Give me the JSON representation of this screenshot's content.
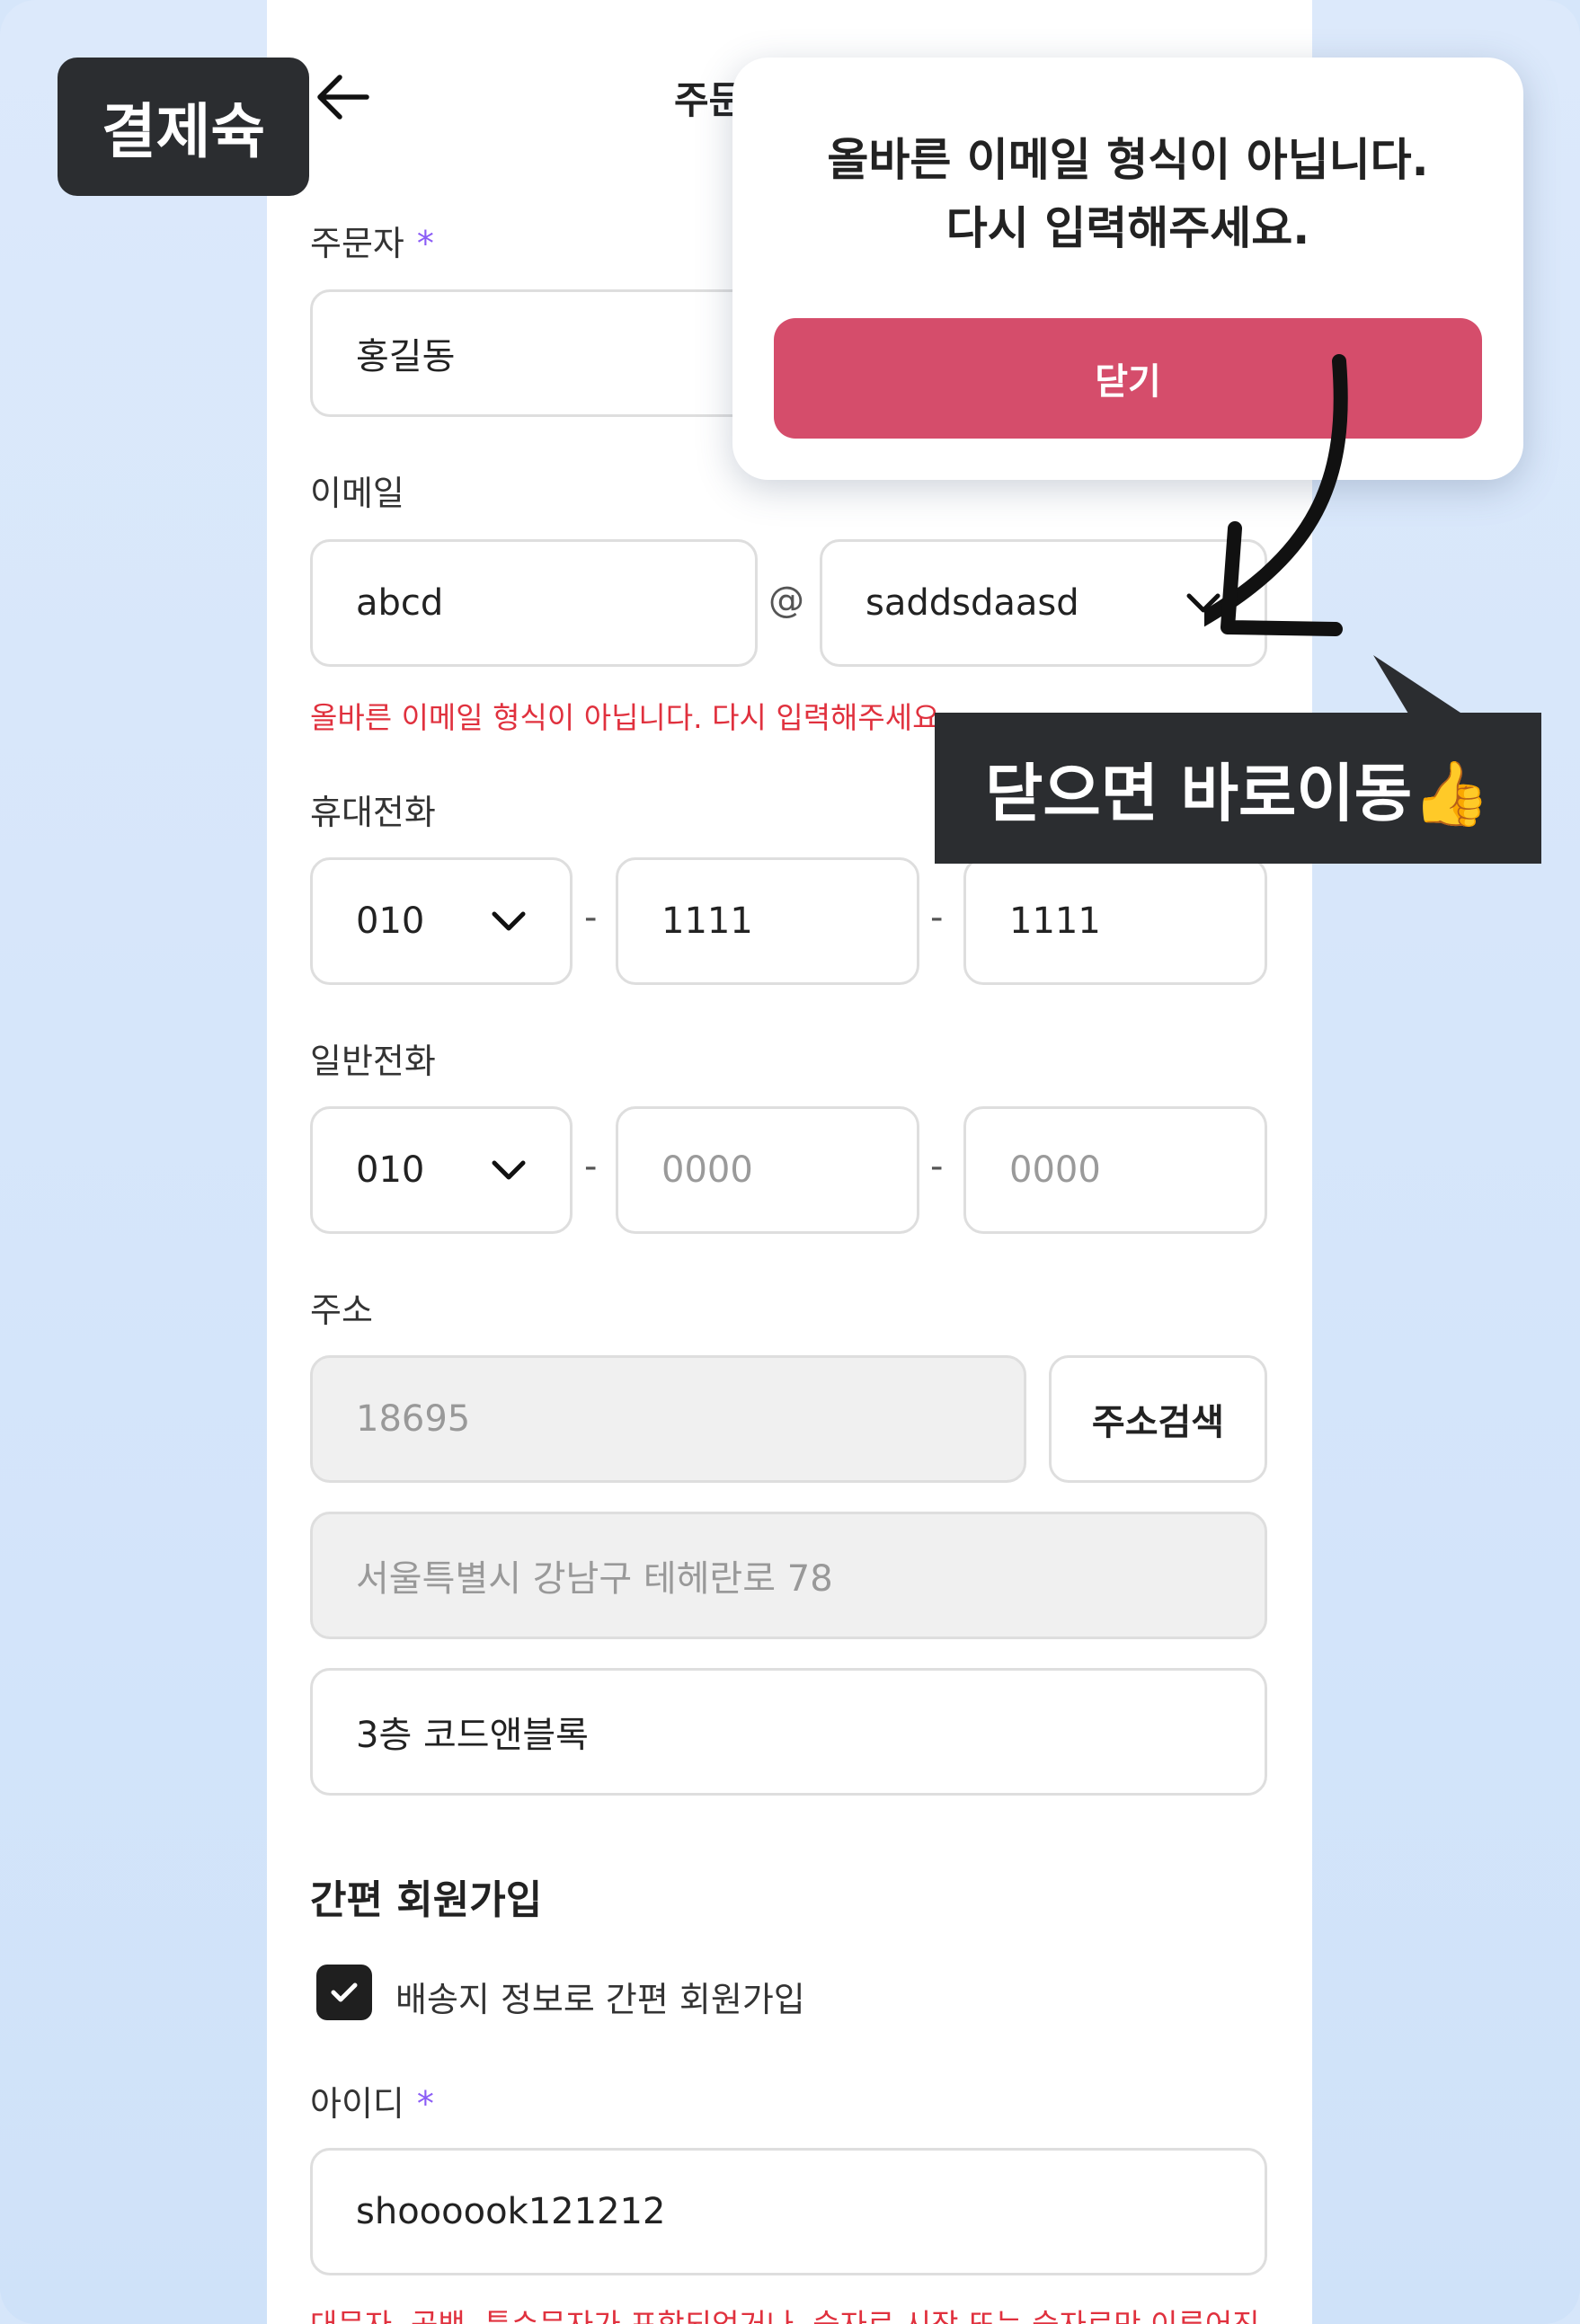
{
  "header": {
    "title": "주문"
  },
  "corner_tag": "결제슉",
  "modal": {
    "line1": "올바른 이메일 형식이 아닙니다.",
    "line2": "다시 입력해주세요.",
    "close_label": "닫기"
  },
  "callout": {
    "text": "닫으면 바로이동👍"
  },
  "orderer": {
    "label": "주문자",
    "required_mark": "*",
    "value": "홍길동"
  },
  "email": {
    "label": "이메일",
    "local": "abcd",
    "at": "@",
    "domain": "saddsdaasd",
    "error": "올바른 이메일 형식이 아닙니다. 다시 입력해주세요."
  },
  "mobile": {
    "label": "휴대전화",
    "prefix": "010",
    "mid": "1111",
    "last": "1111",
    "dash": "-"
  },
  "phone": {
    "label": "일반전화",
    "prefix": "010",
    "mid_placeholder": "0000",
    "last_placeholder": "0000",
    "dash": "-"
  },
  "address": {
    "label": "주소",
    "zip": "18695",
    "search_label": "주소검색",
    "line1": "서울특별시 강남구 테헤란로 78",
    "line2": "3층 코드앤블록"
  },
  "signup": {
    "title": "간편 회원가입",
    "checkbox_label": "배송지 정보로 간편 회원가입",
    "checked": true
  },
  "userid": {
    "label": "아이디",
    "required_mark": "*",
    "value": "shoooook121212",
    "error": "대문자, 공백, 특수문자가 포함되었거나, 숫자로 시작 또는 숫자로만 이루어진 아"
  },
  "colors": {
    "accent": "#d54d6b",
    "error": "#e0313e",
    "required": "#8b5cf6",
    "dark": "#2b2d30"
  },
  "icons": [
    "back-arrow-icon",
    "chevron-down-icon",
    "check-icon",
    "curved-arrow-icon"
  ]
}
